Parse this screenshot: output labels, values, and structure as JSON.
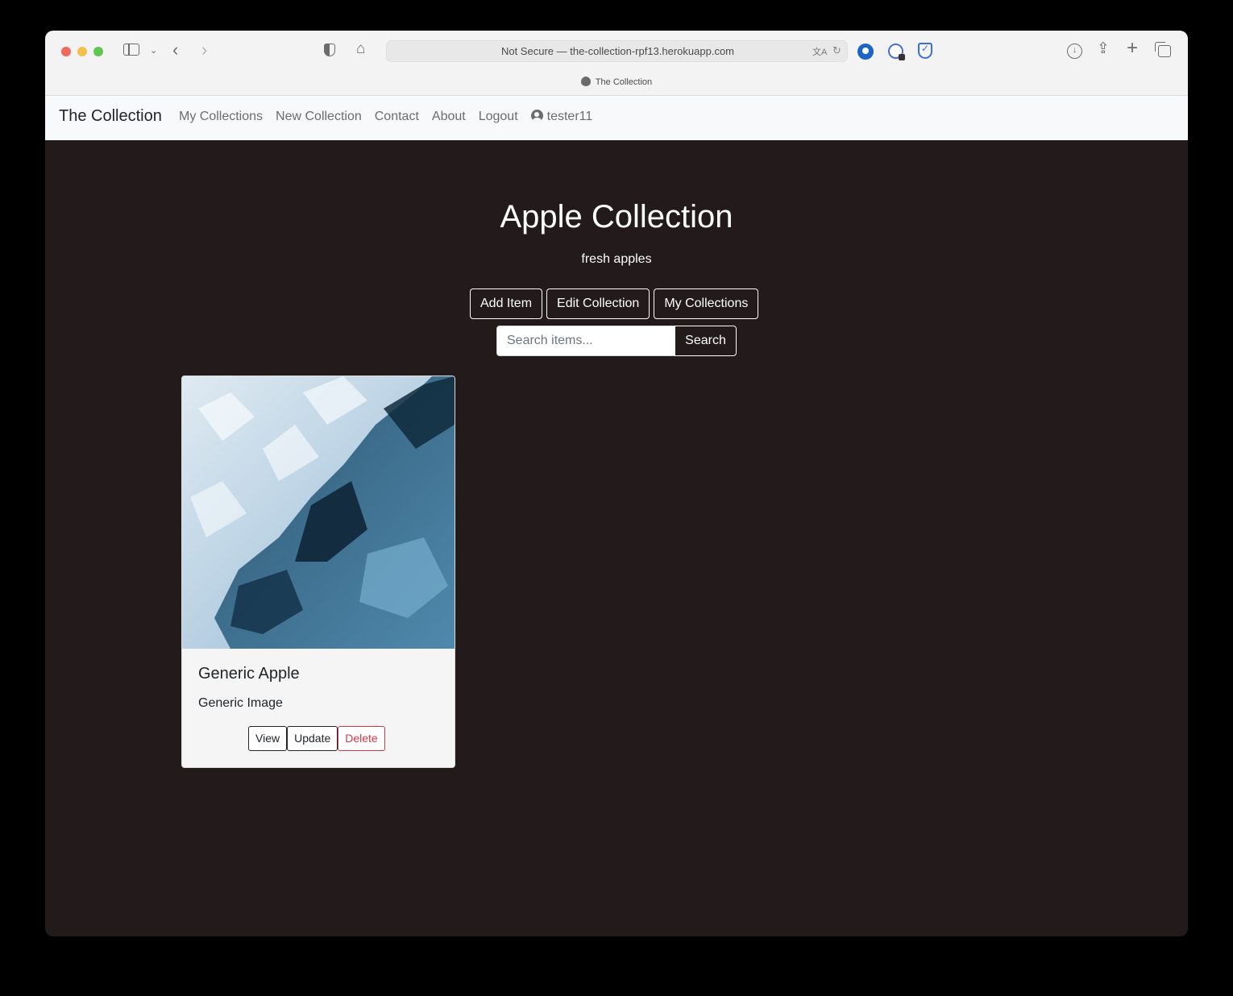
{
  "browser": {
    "address": "Not Secure — the-collection-rpf13.herokuapp.com",
    "tab_title": "The Collection"
  },
  "navbar": {
    "brand": "The Collection",
    "links": [
      "My Collections",
      "New Collection",
      "Contact",
      "About",
      "Logout"
    ],
    "username": "tester11"
  },
  "collection": {
    "title": "Apple Collection",
    "description": "fresh apples",
    "buttons": {
      "add_item": "Add Item",
      "edit": "Edit Collection",
      "my_collections": "My Collections"
    },
    "search": {
      "placeholder": "Search items...",
      "button": "Search"
    }
  },
  "items": [
    {
      "title": "Generic Apple",
      "text": "Generic Image",
      "buttons": {
        "view": "View",
        "update": "Update",
        "delete": "Delete"
      }
    }
  ],
  "colors": {
    "page_bg": "#221a1b",
    "navbar_bg": "#f8f9fa",
    "danger": "#dc3545"
  }
}
